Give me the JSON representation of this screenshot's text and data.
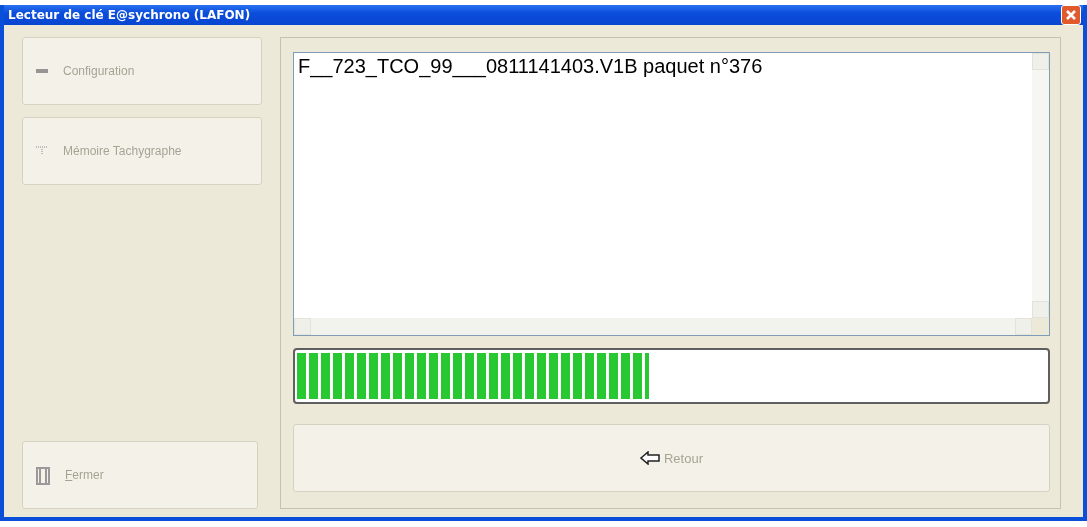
{
  "window": {
    "title": "Lecteur de clé E@sychrono (LAFON)"
  },
  "sidebar": {
    "buttons": [
      {
        "kind": "config",
        "label": "Configuration",
        "disabled": true
      },
      {
        "kind": "memory",
        "label": "Mémoire Tachygraphe",
        "disabled": true
      }
    ],
    "close_button": {
      "label": "Fermer",
      "disabled": true
    }
  },
  "log": {
    "lines": [
      "F__723_TCO_99___0811141403.V1B paquet n°376"
    ]
  },
  "progress": {
    "level": 0.47
  },
  "back_button": {
    "label": "Retour",
    "disabled": true
  }
}
